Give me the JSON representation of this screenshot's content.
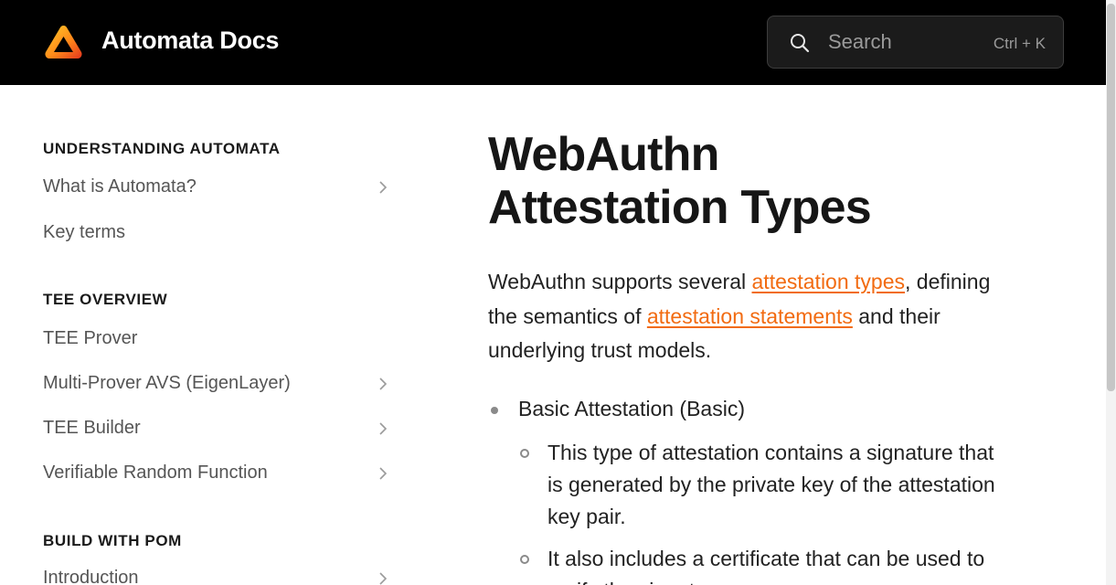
{
  "header": {
    "brand": "Automata Docs",
    "logo_icon": "automata-triangle-logo",
    "search": {
      "placeholder": "Search",
      "shortcut": "Ctrl + K",
      "icon": "search-icon"
    },
    "colors": {
      "background": "#000000",
      "text": "#ffffff"
    }
  },
  "sidebar": {
    "sections": [
      {
        "title": "UNDERSTANDING AUTOMATA",
        "items": [
          {
            "label": "What is Automata?",
            "expandable": true
          },
          {
            "label": "Key terms",
            "expandable": false
          }
        ]
      },
      {
        "title": "TEE OVERVIEW",
        "items": [
          {
            "label": "TEE Prover",
            "expandable": false
          },
          {
            "label": "Multi-Prover AVS (EigenLayer)",
            "expandable": true
          },
          {
            "label": "TEE Builder",
            "expandable": true
          },
          {
            "label": "Verifiable Random Function",
            "expandable": true
          }
        ]
      },
      {
        "title": "BUILD WITH POM",
        "items": [
          {
            "label": "Introduction",
            "expandable": true
          }
        ]
      }
    ]
  },
  "main": {
    "title_line1": "WebAuthn",
    "title_line2": "Attestation Types",
    "intro": {
      "part1": "WebAuthn supports several ",
      "link1": "attestation types",
      "part2": ", defining the semantics of ",
      "link2": "attestation statements",
      "part3": " and their underlying trust models."
    },
    "list": [
      {
        "label": "Basic Attestation (Basic)",
        "children": [
          "This type of attestation contains a signature that is generated by the private key of the attestation key pair.",
          "It also includes a certificate that can be used to verify the signature."
        ]
      }
    ],
    "link_color": "#f26b11"
  }
}
